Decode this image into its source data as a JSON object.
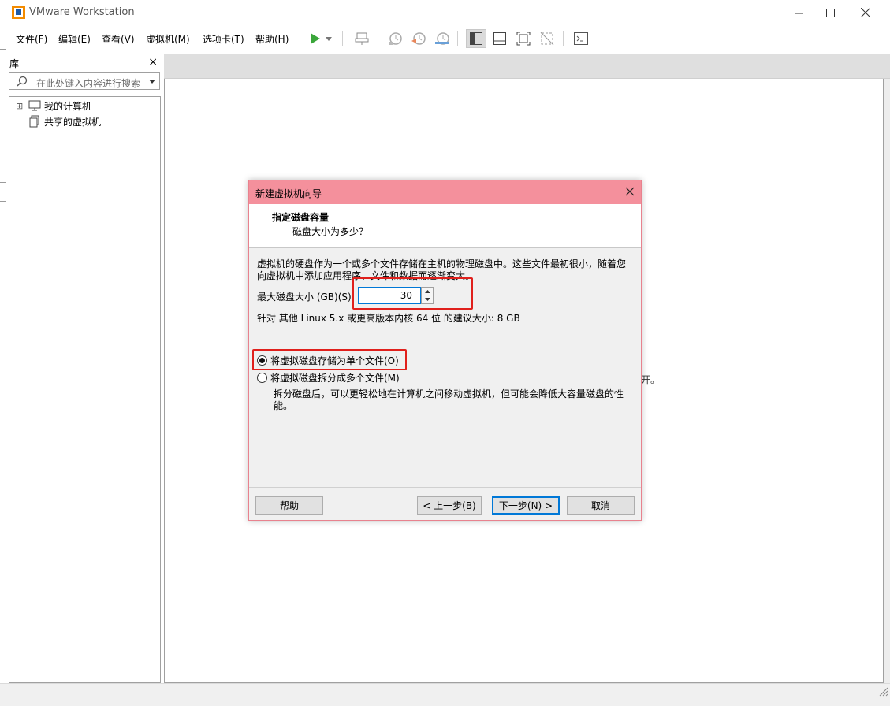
{
  "window": {
    "title": "VMware Workstation"
  },
  "menu": {
    "items": [
      "文件(F)",
      "编辑(E)",
      "查看(V)",
      "虚拟机(M)",
      "选项卡(T)",
      "帮助(H)"
    ]
  },
  "toolbar": {
    "icons": [
      "play-icon",
      "dropdown-icon",
      "send-ctrl-alt-del-icon",
      "snapshot-icon",
      "revert-snapshot-icon",
      "snapshot-manager-icon",
      "library-view-icon",
      "thumbnail-bar-icon",
      "fullscreen-icon",
      "unity-icon",
      "console-icon"
    ]
  },
  "library": {
    "title": "库",
    "close": "×",
    "search_placeholder": "在此处键入内容进行搜索",
    "tree": [
      {
        "label": "我的计算机",
        "icon": "computer-icon",
        "expander": "⊞"
      },
      {
        "label": "共享的虚拟机",
        "icon": "shared-vm-icon"
      }
    ]
  },
  "background": {
    "fragment": "开。"
  },
  "dialog": {
    "title": "新建虚拟机向导",
    "heading": "指定磁盘容量",
    "subheading": "磁盘大小为多少？",
    "description": "虚拟机的硬盘作为一个或多个文件存储在主机的物理磁盘中。这些文件最初很小，随着您向虚拟机中添加应用程序、文件和数据而逐渐变大。",
    "size_label": "最大磁盘大小 (GB)(S):",
    "size_value": "30",
    "recommendation": "针对 其他 Linux 5.x 或更高版本内核 64 位 的建议大小: 8 GB",
    "radio_single": "将虚拟磁盘存储为单个文件(O)",
    "radio_single_checked": true,
    "radio_multiple": "将虚拟磁盘拆分成多个文件(M)",
    "split_note": "拆分磁盘后，可以更轻松地在计算机之间移动虚拟机，但可能会降低大容量磁盘的性能。",
    "buttons": {
      "help": "帮助",
      "back": "< 上一步(B)",
      "next": "下一步(N) >",
      "cancel": "取消"
    },
    "accent_color": "#f4909c",
    "highlight_color": "#e0201c"
  }
}
